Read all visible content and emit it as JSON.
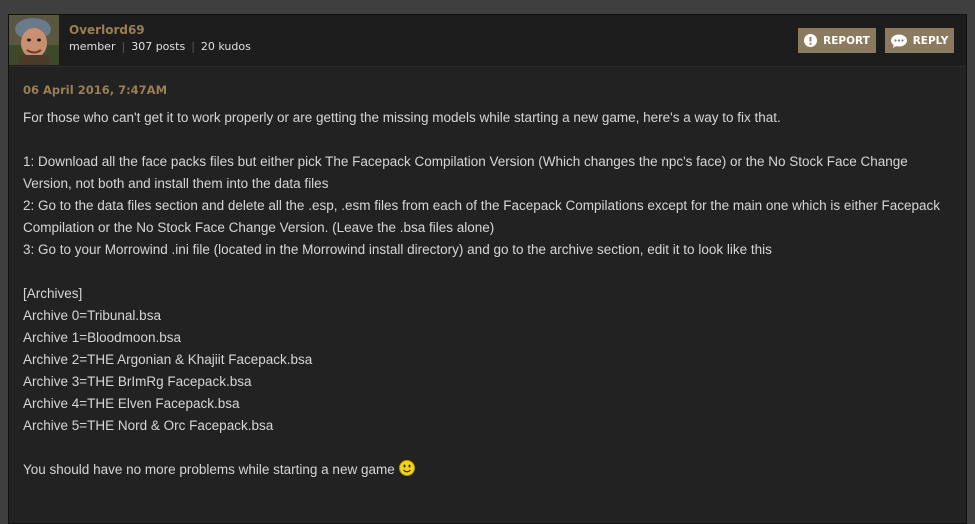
{
  "user": {
    "username": "Overlord69",
    "role": "member",
    "posts": "307 posts",
    "kudos": "20 kudos"
  },
  "actions": {
    "report_label": "REPORT",
    "reply_label": "REPLY"
  },
  "post": {
    "date": "06 April 2016, 7:47AM",
    "intro": "For those who can't get it to work properly or are getting the missing models while starting a new game, here's a way to fix that.",
    "step1": "1: Download all the face packs files but either pick The Facepack Compilation Version (Which changes the npc's face) or the No Stock Face Change Version, not both and install them into the data files",
    "step2": "2: Go to the data files section and delete all the .esp, .esm files from each of the Facepack Compilations except for the main one which is either Facepack Compilation or the No Stock Face Change Version. (Leave the .bsa files alone)",
    "step3": "3: Go to your Morrowind .ini file (located in the Morrowind install directory) and go to the archive section, edit it to look like this",
    "archives_header": "[Archives]",
    "archives": [
      "Archive 0=Tribunal.bsa",
      "Archive 1=Bloodmoon.bsa",
      "Archive 2=THE Argonian & Khajiit Facepack.bsa",
      "Archive 3=THE BrImRg Facepack.bsa",
      "Archive 4=THE Elven Facepack.bsa",
      "Archive 5=THE Nord & Orc Facepack.bsa"
    ],
    "closing": "You should have no more problems while starting a new game"
  },
  "icons": {
    "report": "exclamation-circle-icon",
    "reply": "speech-bubble-icon",
    "smiley": "smiley-emoticon"
  },
  "colors": {
    "accent": "#9a7e55",
    "button": "#8a7a5e",
    "panel": "#222222",
    "text": "#d6d6d6"
  }
}
